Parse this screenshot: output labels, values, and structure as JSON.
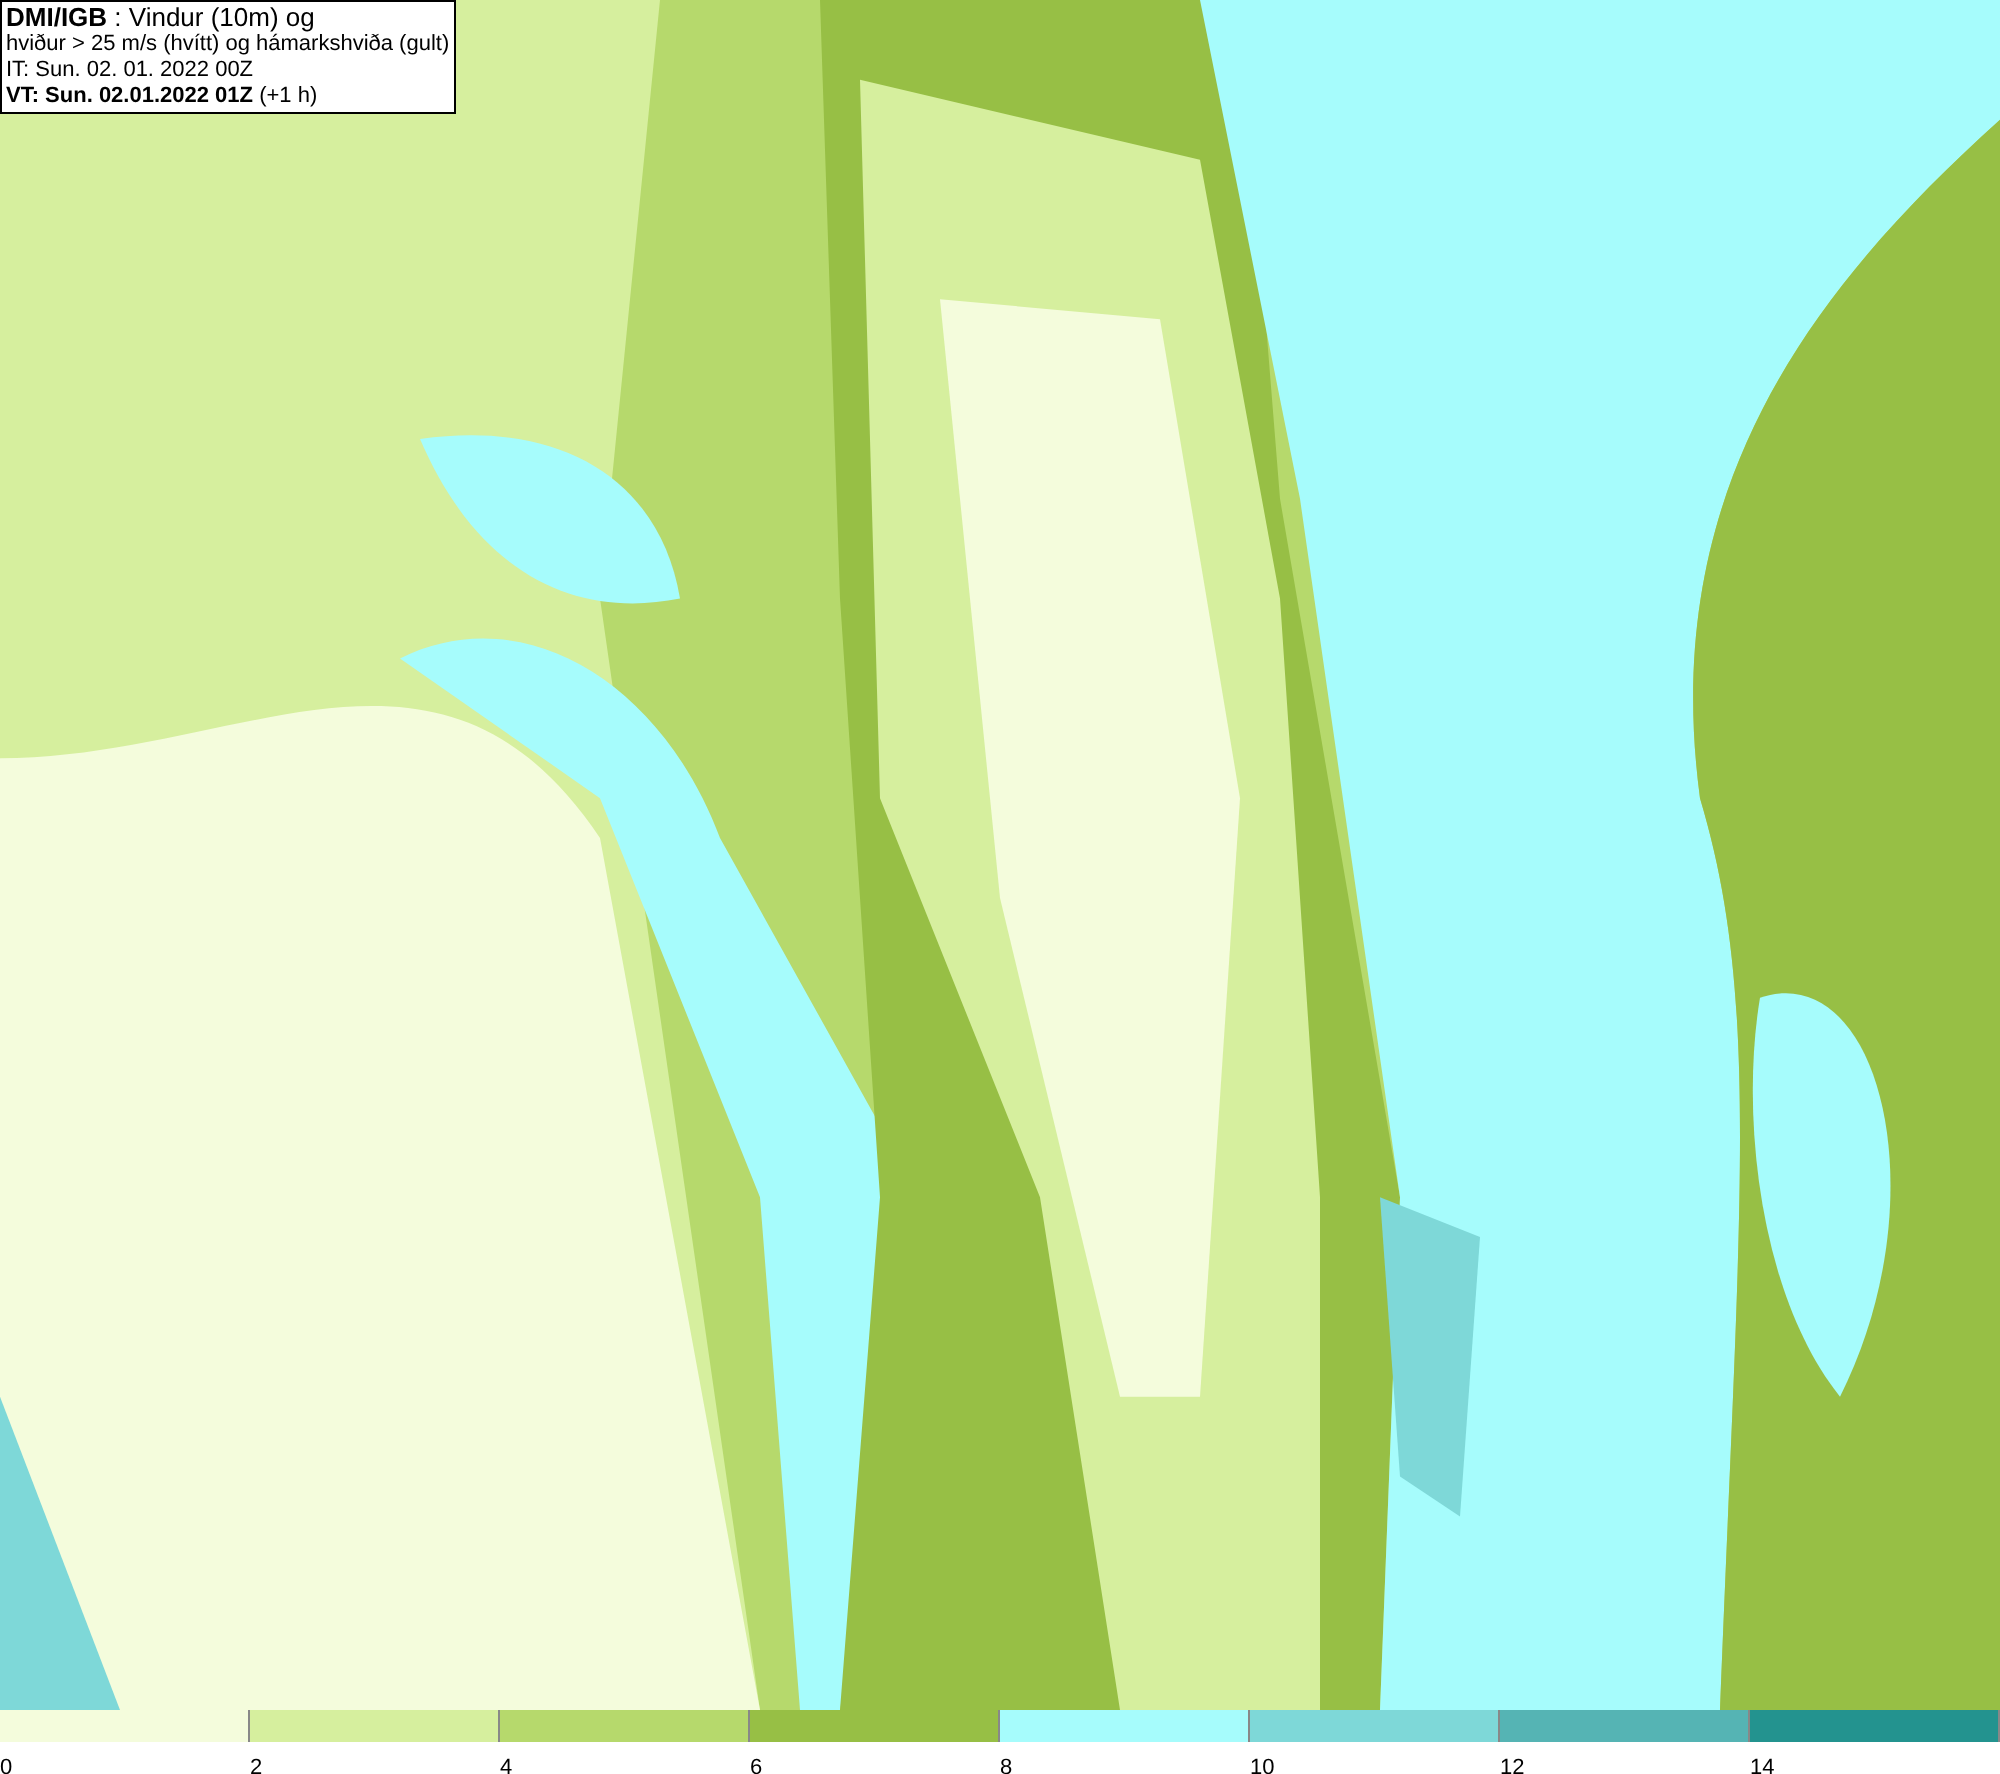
{
  "title_box": {
    "lines": [
      "**DMI/IGB** : Vindur (10m) og",
      "hviður > 25 m/s (hvítt) og hámarkshviða (gult)",
      "IT: Sun. 02. 01. 2022 00Z",
      "**VT: Sun. 02.01.2022 01Z** (+1 h)"
    ]
  },
  "legend": {
    "segments": [
      {
        "label": "0",
        "color": "#f4fcdc"
      },
      {
        "label": "2",
        "color": "#d6ef9e"
      },
      {
        "label": "4",
        "color": "#b6d96c"
      },
      {
        "label": "6",
        "color": "#97bf45"
      },
      {
        "label": "8",
        "color": "#a6fcfc"
      },
      {
        "label": "10",
        "color": "#7ed8d8"
      },
      {
        "label": "12",
        "color": "#55b4b4"
      },
      {
        "label": "14",
        "color": "#23938f"
      }
    ]
  }
}
